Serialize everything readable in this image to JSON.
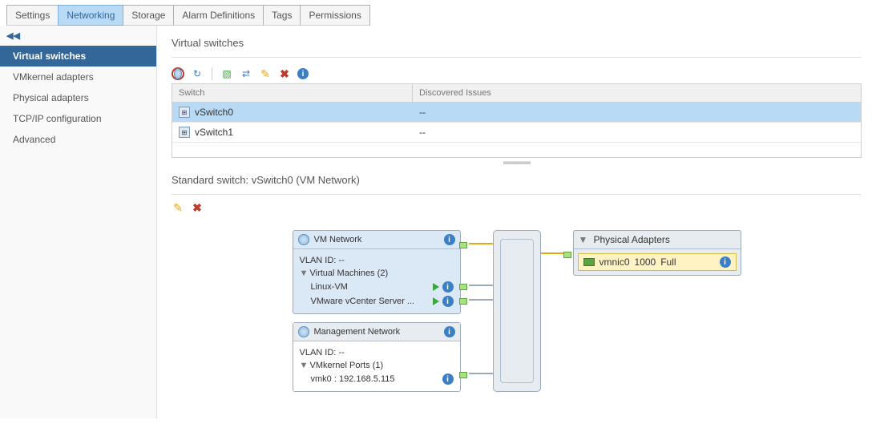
{
  "tabs": [
    "Settings",
    "Networking",
    "Storage",
    "Alarm Definitions",
    "Tags",
    "Permissions"
  ],
  "active_tab": "Networking",
  "sidebar": {
    "items": [
      "Virtual switches",
      "VMkernel adapters",
      "Physical adapters",
      "TCP/IP configuration",
      "Advanced"
    ],
    "active": "Virtual switches"
  },
  "section_title": "Virtual switches",
  "switch_table": {
    "headers": [
      "Switch",
      "Discovered Issues"
    ],
    "rows": [
      {
        "name": "vSwitch0",
        "issues": "--"
      },
      {
        "name": "vSwitch1",
        "issues": "--"
      }
    ],
    "selected": 0
  },
  "detail_title": "Standard switch: vSwitch0 (VM Network)",
  "diagram": {
    "vm_network": {
      "title": "VM Network",
      "vlan": "VLAN ID: --",
      "group_label": "Virtual Machines (2)",
      "vms": [
        "Linux-VM",
        "VMware vCenter Server ..."
      ]
    },
    "mgmt_network": {
      "title": "Management Network",
      "vlan": "VLAN ID: --",
      "group_label": "VMkernel Ports (1)",
      "port_line": "vmk0 : 192.168.5.115"
    },
    "phys": {
      "title": "Physical Adapters",
      "nic_name": "vmnic0",
      "nic_speed": "1000",
      "nic_duplex": "Full"
    }
  }
}
